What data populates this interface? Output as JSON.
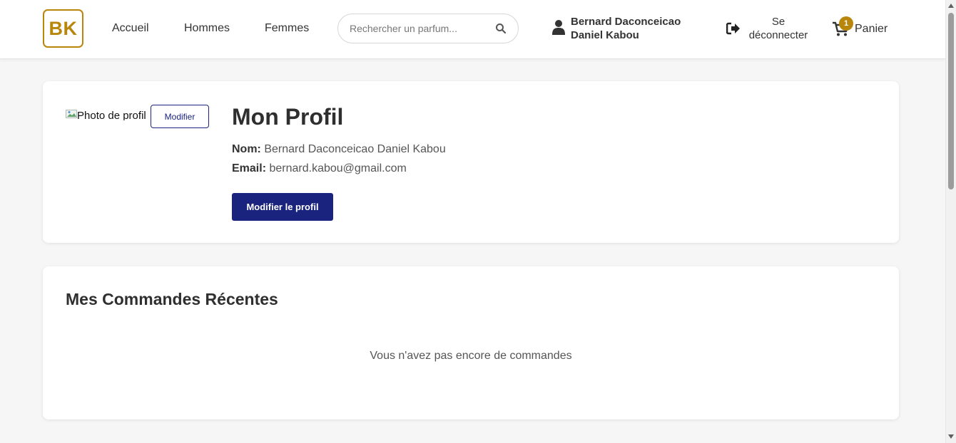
{
  "header": {
    "logo": "BK",
    "nav": [
      {
        "label": "Accueil"
      },
      {
        "label": "Hommes"
      },
      {
        "label": "Femmes"
      }
    ],
    "search": {
      "placeholder": "Rechercher un parfum..."
    },
    "user": {
      "name_line1": "Bernard Daconceicao",
      "name_line2": "Daniel Kabou"
    },
    "logout": {
      "line1": "Se",
      "line2": "déconnecter"
    },
    "cart": {
      "label": "Panier",
      "count": "1"
    }
  },
  "profile": {
    "photo_alt": "Photo de profil",
    "photo_edit_label": "Modifier",
    "title": "Mon Profil",
    "name_label": "Nom:",
    "name_value": "Bernard Daconceicao Daniel Kabou",
    "email_label": "Email:",
    "email_value": "bernard.kabou@gmail.com",
    "edit_button": "Modifier le profil"
  },
  "orders": {
    "title": "Mes Commandes Récentes",
    "empty_message": "Vous n'avez pas encore de commandes"
  },
  "colors": {
    "brand_gold": "#b8860b",
    "primary_navy": "#1a237e"
  },
  "icons": {
    "search": "search-icon",
    "user": "user-icon",
    "logout": "sign-out-icon",
    "cart": "shopping-cart-icon"
  }
}
